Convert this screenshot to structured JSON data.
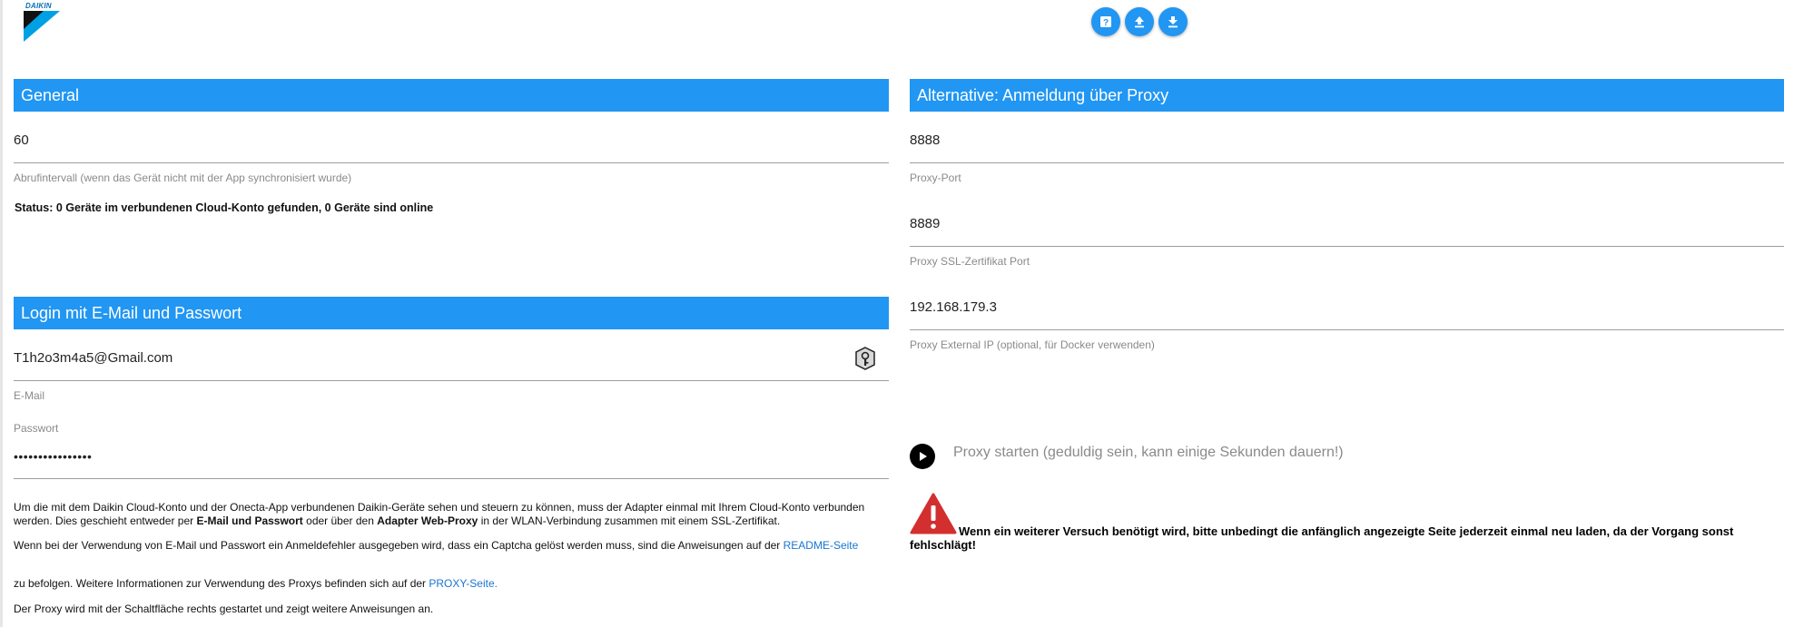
{
  "brand": {
    "logo_text": "DAIKIN",
    "logo_color": "#0a6fb8"
  },
  "toolbar": {
    "icons": [
      "help-icon",
      "upload-icon",
      "download-icon"
    ],
    "accent": "#2196f3"
  },
  "general": {
    "header": "General",
    "interval_value": "60",
    "interval_label": "Abrufintervall (wenn das Gerät nicht mit der App synchronisiert wurde)",
    "status": "Status: 0 Geräte im verbundenen Cloud-Konto gefunden, 0 Geräte sind online"
  },
  "login": {
    "header": "Login mit E-Mail und Passwort",
    "email_value": "T1h2o3m4a5@Gmail.com",
    "email_label": "E-Mail",
    "password_label": "Passwort",
    "password_value": "••••••••••••••••"
  },
  "info": {
    "p1": "Um die mit dem Daikin Cloud-Konto und der Onecta-App verbundenen Daikin-Geräte sehen und steuern zu können, muss der Adapter einmal mit Ihrem Cloud-Konto verbunden werden. Dies geschieht entweder per ",
    "p1_b1": "E-Mail und Passwort",
    "p1_mid": " oder über den ",
    "p1_b2": "Adapter Web-Proxy",
    "p1_end": " in der WLAN-Verbindung zusammen mit einem SSL-Zertifikat.",
    "p2": "Wenn bei der Verwendung von E-Mail und Passwort ein Anmeldefehler ausgegeben wird, dass ein Captcha gelöst werden muss, sind die Anweisungen auf der ",
    "p2_link": "README-Seite",
    "p3": "zu befolgen. Weitere Informationen zur Verwendung des Proxys befinden sich auf der ",
    "p3_link": "PROXY-Seite.",
    "p4": "Der Proxy wird mit der Schaltfläche rechts gestartet und zeigt weitere Anweisungen an."
  },
  "proxy": {
    "header": "Alternative: Anmeldung über Proxy",
    "port_value": "8888",
    "port_label": "Proxy-Port",
    "ssl_port_value": "8889",
    "ssl_port_label": "Proxy SSL-Zertifikat Port",
    "ext_ip_value": "192.168.179.3",
    "ext_ip_label": "Proxy External IP (optional, für Docker verwenden)",
    "start_label": "Proxy starten (geduldig sein, kann einige Sekunden dauern!)",
    "warning": "Wenn ein weiterer Versuch benötigt wird, bitte unbedingt die anfänglich angezeigte Seite jederzeit einmal neu laden, da der Vorgang sonst fehlschlägt!",
    "warning_color": "#d32f2f"
  }
}
